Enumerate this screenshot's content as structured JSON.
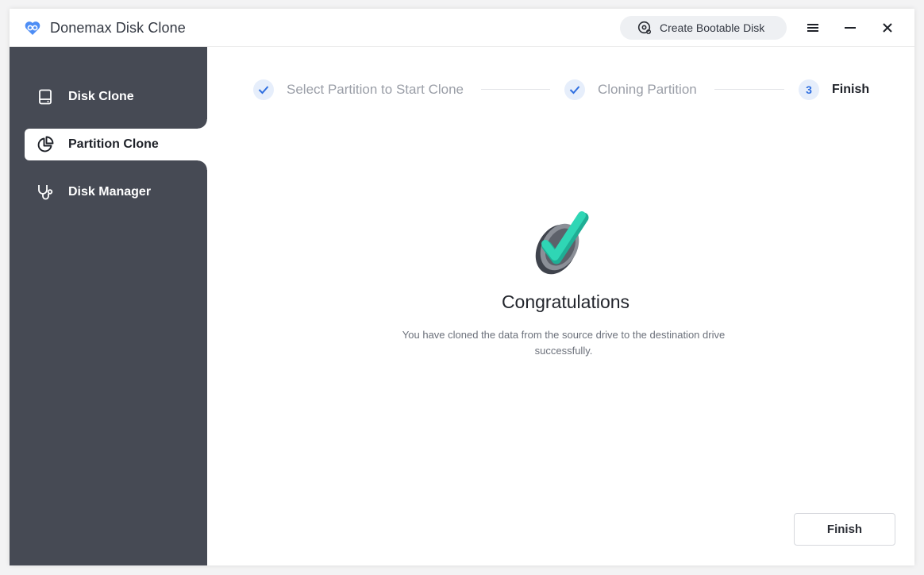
{
  "app": {
    "title": "Donemax Disk Clone",
    "logo_icon": "donemax-logo-icon"
  },
  "titlebar": {
    "bootable_button": {
      "label": "Create Bootable Disk",
      "icon": "bootable-disk-icon"
    },
    "menu_icon": "hamburger-menu-icon",
    "minimize_icon": "minimize-icon",
    "close_icon": "close-icon"
  },
  "sidebar": {
    "items": [
      {
        "label": "Disk Clone",
        "icon": "hard-drive-icon",
        "active": false
      },
      {
        "label": "Partition Clone",
        "icon": "pie-chart-icon",
        "active": true
      },
      {
        "label": "Disk Manager",
        "icon": "stethoscope-icon",
        "active": false
      }
    ]
  },
  "stepper": {
    "steps": [
      {
        "label": "Select Partition to Start Clone",
        "state": "done",
        "marker": "✓"
      },
      {
        "label": "Cloning Partition",
        "state": "done",
        "marker": "✓"
      },
      {
        "label": "Finish",
        "state": "current",
        "marker": "3"
      }
    ]
  },
  "result": {
    "heading": "Congratulations",
    "message": "You have cloned the data from the source drive to the destination drive successfully."
  },
  "footer": {
    "finish_label": "Finish"
  },
  "colors": {
    "sidebar_bg": "#464a54",
    "accent_blue": "#2f6fe0",
    "step_circle_bg": "#e6eefb",
    "success_teal": "#2fd6b5"
  }
}
